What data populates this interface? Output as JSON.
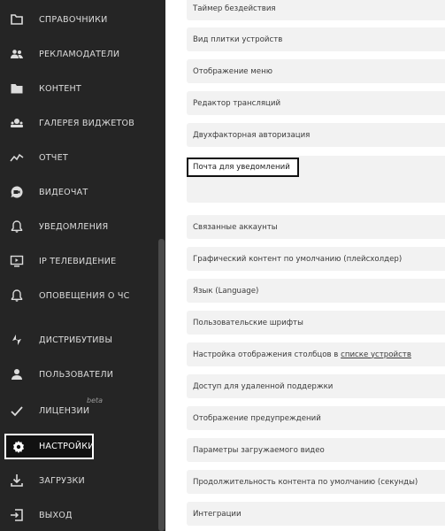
{
  "sidebar": {
    "items": [
      {
        "label": "СПРАВОЧНИКИ",
        "icon": "folder-outline-icon"
      },
      {
        "label": "РЕКЛАМОДАТЕЛИ",
        "icon": "people-icon"
      },
      {
        "label": "КОНТЕНТ",
        "icon": "folder-icon"
      },
      {
        "label": "ГАЛЕРЕЯ ВИДЖЕТОВ",
        "icon": "widgets-icon"
      },
      {
        "label": "ОТЧЕТ",
        "icon": "chart-line-icon"
      },
      {
        "label": "ВИДЕОЧАТ",
        "icon": "video-chat-icon"
      },
      {
        "label": "УВЕДОМЛЕНИЯ",
        "icon": "bell-icon"
      },
      {
        "label": "IP ТЕЛЕВИДЕНИЕ",
        "icon": "tv-icon"
      },
      {
        "label": "ОПОВЕЩЕНИЯ О ЧС",
        "icon": "alert-bell-icon"
      },
      {
        "label": "ДИСТРИБУТИВЫ",
        "icon": "distributive-icon"
      },
      {
        "label": "ПОЛЬЗОВАТЕЛИ",
        "icon": "user-icon"
      },
      {
        "label": "ЛИЦЕНЗИИ",
        "icon": "checkmark-icon",
        "badge": "beta"
      },
      {
        "label": "НАСТРОЙКИ",
        "icon": "gear-icon",
        "active": true
      },
      {
        "label": "ЗАГРУЗКИ",
        "icon": "download-icon"
      },
      {
        "label": "ВЫХОД",
        "icon": "logout-icon"
      }
    ]
  },
  "settings": {
    "rows": [
      "Таймер бездействия",
      "Вид плитки устройств",
      "Отображение меню",
      "Редактор трансляций",
      "Двухфакторная авторизация",
      "Почта для уведомлений",
      "Связанные аккаунты",
      "Графический контент по умолчанию (плейсхолдер)",
      "Язык (Language)",
      "Пользовательские шрифты",
      "Настройка отображения столбцов в",
      "Доступ для удаленной поддержки",
      "Отображение предупреждений",
      "Параметры загружаемого видео",
      "Продолжительность контента по умолчанию (секунды)",
      "Интеграции"
    ],
    "link_text": "списке устройств"
  }
}
